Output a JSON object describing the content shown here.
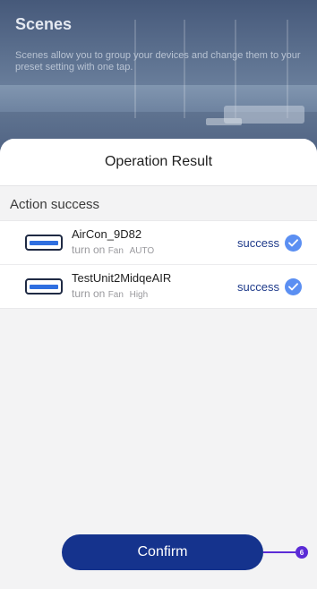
{
  "background": {
    "title": "Scenes",
    "description": "Scenes allow you to group your devices and change them to your preset setting with one tap."
  },
  "sheet": {
    "title": "Operation Result",
    "section_label": "Action success",
    "results": [
      {
        "device": "AirCon_9D82",
        "verb": "turn on",
        "mode": "Fan",
        "setting": "AUTO",
        "status": "success"
      },
      {
        "device": "TestUnit2MidqeAIR",
        "verb": "turn on",
        "mode": "Fan",
        "setting": "High",
        "status": "success"
      }
    ],
    "confirm_label": "Confirm"
  },
  "annotation": {
    "step_number": "6"
  },
  "colors": {
    "primary": "#15338d",
    "success_text": "#1e3a8a",
    "check": "#5b8ff2",
    "annotation": "#5b2bd6"
  },
  "icons": {
    "device": "air-conditioner-icon",
    "status": "checkmark-circle-icon"
  }
}
